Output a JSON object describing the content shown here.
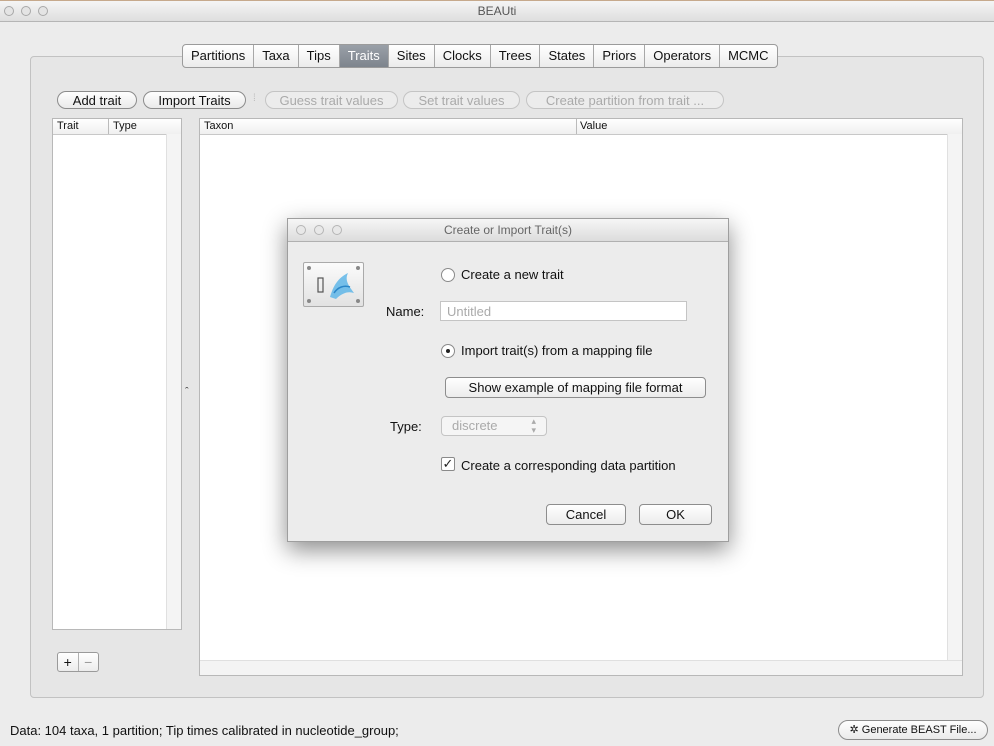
{
  "window": {
    "title": "BEAUti"
  },
  "tabs": [
    "Partitions",
    "Taxa",
    "Tips",
    "Traits",
    "Sites",
    "Clocks",
    "Trees",
    "States",
    "Priors",
    "Operators",
    "MCMC"
  ],
  "active_tab": "Traits",
  "toolbar": {
    "add_trait": "Add trait",
    "import_traits": "Import Traits",
    "guess_trait_values": "Guess trait values",
    "set_trait_values": "Set trait values",
    "create_partition": "Create partition from trait ..."
  },
  "trait_table": {
    "col_trait": "Trait",
    "col_type": "Type"
  },
  "taxon_table": {
    "col_taxon": "Taxon",
    "col_value": "Value"
  },
  "list_buttons": {
    "add": "+",
    "remove": "−"
  },
  "status": {
    "text": "Data: 104 taxa, 1 partition; Tip times calibrated in nucleotide_group;"
  },
  "generate_button": "Generate BEAST File...",
  "dialog": {
    "title": "Create or Import Trait(s)",
    "create_new_trait": "Create a new trait",
    "name_label": "Name:",
    "name_placeholder": "Untitled",
    "import_from_file": "Import trait(s) from a mapping file",
    "show_example": "Show example of mapping file format",
    "type_label": "Type:",
    "type_value": "discrete",
    "create_partition_checkbox": "Create a corresponding data partition",
    "cancel": "Cancel",
    "ok": "OK"
  }
}
